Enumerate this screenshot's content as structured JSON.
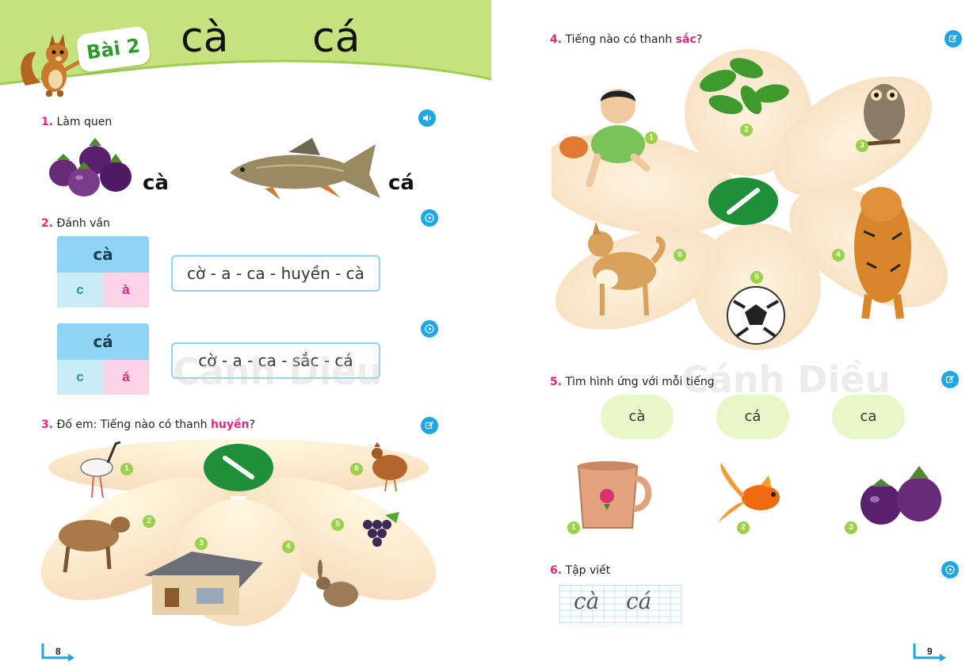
{
  "colors": {
    "accent_pink": "#e0267f",
    "accent_blue": "#1fa6e6",
    "green_band": "#c5e27f",
    "number_green": "#9bd148"
  },
  "header": {
    "lesson_label": "Bài 2",
    "word_1": "cà",
    "word_2": "cá"
  },
  "sec1": {
    "num": "1.",
    "title": "Làm quen",
    "word_1": "cà",
    "word_2": "cá",
    "icon": "speaker-icon"
  },
  "sec2": {
    "num": "2.",
    "title": "Đánh vần",
    "rows": [
      {
        "syllable": "cà",
        "onset": "c",
        "rime": "à",
        "spelling": "cờ - a - ca - huyền - cà"
      },
      {
        "syllable": "cá",
        "onset": "c",
        "rime": "á",
        "spelling": "cờ - a - ca - sắc - cá"
      }
    ],
    "icon": "play-icon"
  },
  "sec3": {
    "num": "3.",
    "title_pre": "Đố em: Tiếng nào có thanh ",
    "title_hl": "huyền",
    "title_post": "?",
    "mark": "\\",
    "numbers": [
      "1",
      "2",
      "3",
      "4",
      "5",
      "6"
    ],
    "icon": "edit-icon"
  },
  "sec4": {
    "num": "4.",
    "title_pre": "Tiếng nào có thanh ",
    "title_hl": "sắc",
    "title_post": "?",
    "mark": "/",
    "numbers": [
      "1",
      "2",
      "3",
      "4",
      "5",
      "6"
    ],
    "icon": "edit-icon"
  },
  "sec5": {
    "num": "5.",
    "title": "Tìm hình ứng với mỗi tiếng",
    "words": [
      "cà",
      "cá",
      "ca"
    ],
    "numbers": [
      "1",
      "2",
      "3"
    ],
    "icon": "edit-icon"
  },
  "sec6": {
    "num": "6.",
    "title": "Tập viết",
    "words": [
      "cà",
      "cá"
    ],
    "icon": "play-icon"
  },
  "watermark": "Cánh Diều",
  "pages": {
    "left": "8",
    "right": "9"
  }
}
